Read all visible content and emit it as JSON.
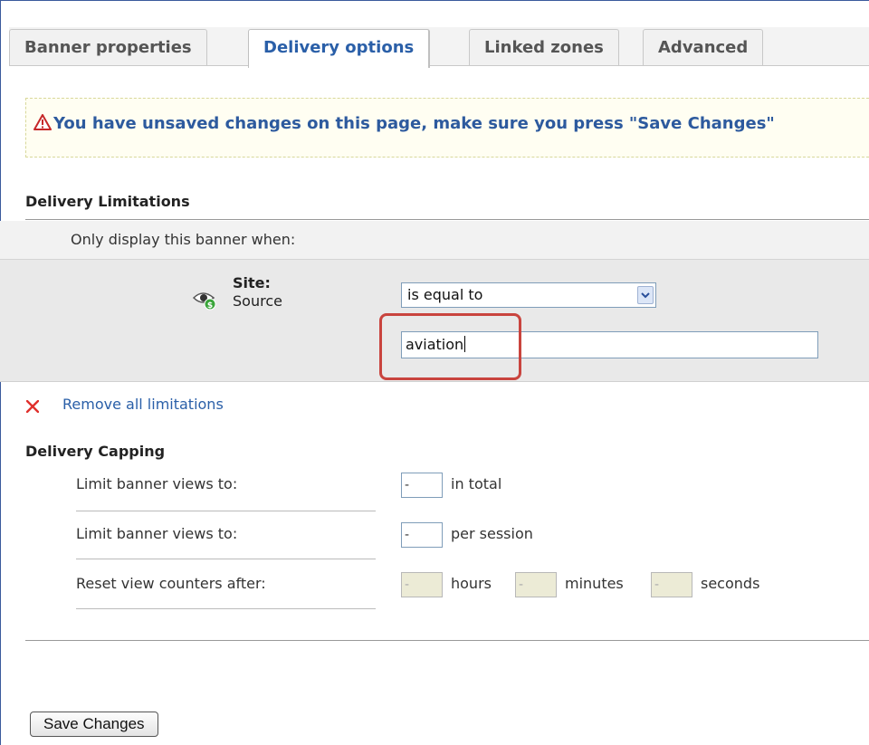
{
  "tabs": [
    {
      "label": "Banner properties",
      "active": false
    },
    {
      "label": "Delivery options",
      "active": true
    },
    {
      "label": "Linked zones",
      "active": false
    },
    {
      "label": "Advanced",
      "active": false
    }
  ],
  "notice": {
    "text": "You have unsaved changes on this page, make sure you press \"Save Changes\"",
    "icon": "warning-icon"
  },
  "limitations": {
    "title": "Delivery Limitations",
    "intro": "Only display this banner when:",
    "condition": {
      "name": "Site:",
      "sub": "Source",
      "icon": "eye-icon",
      "operator": "is equal to",
      "value": "aviation"
    },
    "remove_label": "Remove all limitations"
  },
  "capping": {
    "title": "Delivery Capping",
    "rows": [
      {
        "label": "Limit banner views to:",
        "value": "-",
        "unit": "in total"
      },
      {
        "label": "Limit banner views to:",
        "value": "-",
        "unit": "per session"
      },
      {
        "label": "Reset view counters after:",
        "hours": "-",
        "hours_unit": "hours",
        "minutes": "-",
        "minutes_unit": "minutes",
        "seconds": "-",
        "seconds_unit": "seconds"
      }
    ]
  },
  "save_label": "Save Changes",
  "colors": {
    "accent": "#2a5fa8",
    "highlight": "#c9443e",
    "notice_bg": "#fffef2"
  }
}
